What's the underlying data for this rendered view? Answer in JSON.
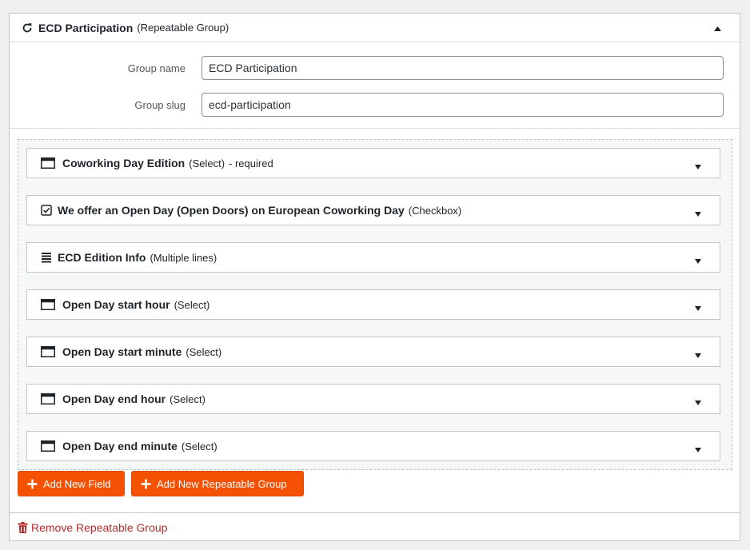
{
  "group": {
    "title": "ECD Participation",
    "type_label": "(Repeatable Group)",
    "icon": "refresh-icon",
    "name_label": "Group name",
    "name_value": "ECD Participation",
    "slug_label": "Group slug",
    "slug_value": "ecd-participation"
  },
  "fields": [
    {
      "name": "Coworking Day Edition",
      "type": "(Select)",
      "extra": "- required",
      "icon": "select-icon"
    },
    {
      "name": "We offer an Open Day (Open Doors) on European Coworking Day",
      "type": "(Checkbox)",
      "extra": "",
      "icon": "checkbox-icon"
    },
    {
      "name": "ECD Edition Info",
      "type": "(Multiple lines)",
      "extra": "",
      "icon": "textarea-icon"
    },
    {
      "name": "Open Day start hour",
      "type": "(Select)",
      "extra": "",
      "icon": "select-icon"
    },
    {
      "name": "Open Day start minute",
      "type": "(Select)",
      "extra": "",
      "icon": "select-icon"
    },
    {
      "name": "Open Day end hour",
      "type": "(Select)",
      "extra": "",
      "icon": "select-icon"
    },
    {
      "name": "Open Day end minute",
      "type": "(Select)",
      "extra": "",
      "icon": "select-icon"
    }
  ],
  "buttons": {
    "add_field": "Add New Field",
    "add_group": "Add New Repeatable Group",
    "remove_group": "Remove Repeatable Group"
  },
  "colors": {
    "accent": "#f55103",
    "danger": "#b32d2e"
  }
}
